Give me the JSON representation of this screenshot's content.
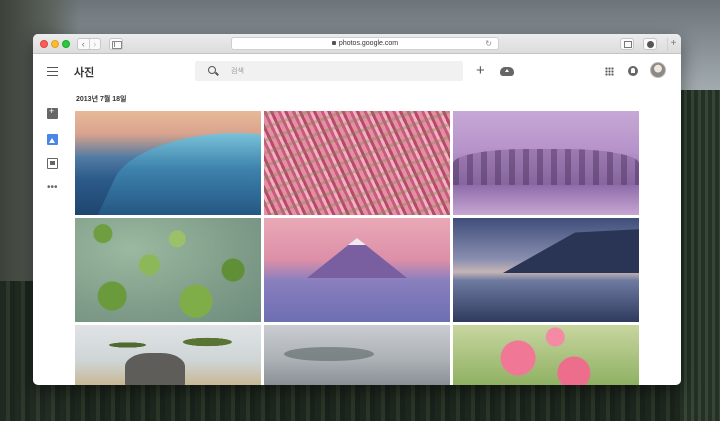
{
  "browser": {
    "url": "photos.google.com",
    "back_label": "‹",
    "forward_label": "›",
    "reload_glyph": "↻",
    "new_tab_glyph": "+"
  },
  "app": {
    "title": "사진",
    "search_placeholder": "검색",
    "create_glyph": "+",
    "more_glyph": "•••"
  },
  "timeline": {
    "date_header": "2013년 7월 18일",
    "photos": [
      {
        "subject": "ocean-wave"
      },
      {
        "subject": "pink-grass"
      },
      {
        "subject": "misty-purple-trees"
      },
      {
        "subject": "lily-pads"
      },
      {
        "subject": "mount-fuji"
      },
      {
        "subject": "lake-reflection"
      },
      {
        "subject": "elephant-savanna"
      },
      {
        "subject": "foggy-landscape"
      },
      {
        "subject": "pink-poppies"
      }
    ]
  },
  "icons": [
    "menu-icon",
    "search-icon",
    "add-icon",
    "upload-icon",
    "apps-icon",
    "notifications-icon",
    "assistant-icon",
    "photos-icon",
    "albums-icon",
    "more-icon",
    "lock-icon",
    "reload-icon",
    "share-icon",
    "downloads-icon"
  ],
  "colors": {
    "accent": "#4a86e8",
    "search_bg": "#f1f1f1"
  }
}
